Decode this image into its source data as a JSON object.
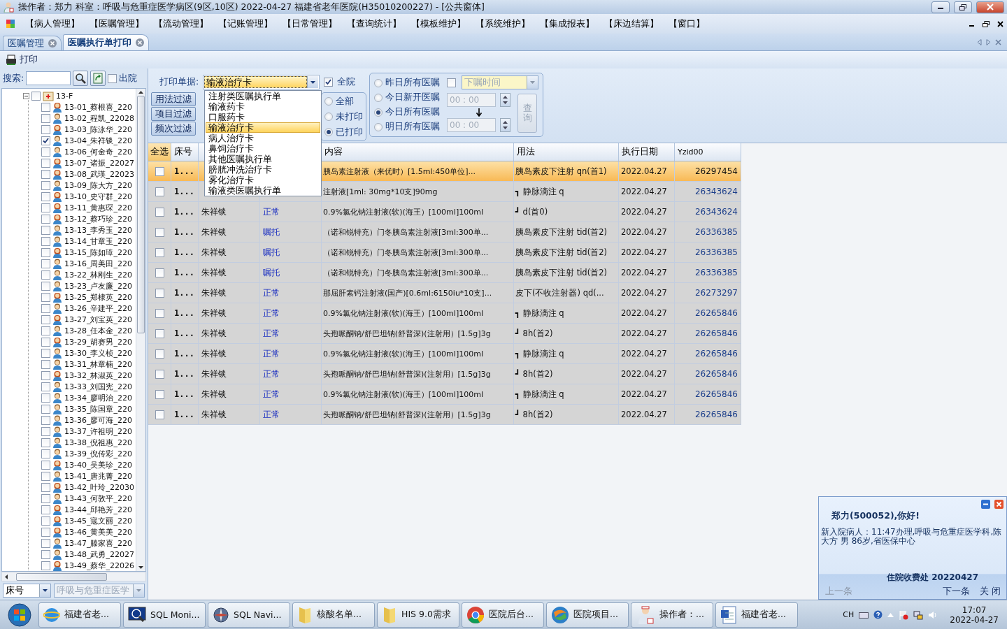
{
  "window": {
    "title": "操作者：郑力  科室：呼吸与危重症医学病区(9区,10区)  2022-04-27  福建省老年医院(H35010200227) - [公共窗体]"
  },
  "menu": [
    "【病人管理】",
    "【医嘱管理】",
    "【流动管理】",
    "【记账管理】",
    "【日常管理】",
    "【查询统计】",
    "【模板维护】",
    "【系统维护】",
    "【集成报表】",
    "【床边结算】",
    "【窗口】"
  ],
  "tabs": [
    {
      "label": "医嘱管理",
      "selected": false
    },
    {
      "label": "医嘱执行单打印",
      "selected": true
    }
  ],
  "toolbar": {
    "print": "打印"
  },
  "sidebar": {
    "search_label": "搜索:",
    "discharged_label": "出院",
    "discharged": false,
    "tree": {
      "label": "13-F",
      "expanded": true,
      "checked": false,
      "children": [
        {
          "label": "13-01_蔡根喜_220",
          "kind": "female",
          "checked": false
        },
        {
          "label": "13-02_程凯_22028",
          "kind": "male",
          "checked": false
        },
        {
          "label": "13-03_陈泳华_220",
          "kind": "female",
          "checked": false
        },
        {
          "label": "13-04_朱祥锬_220",
          "kind": "male",
          "checked": true
        },
        {
          "label": "13-06_何金奇_220",
          "kind": "male",
          "checked": false
        },
        {
          "label": "13-07_诸振_22027",
          "kind": "female",
          "checked": false
        },
        {
          "label": "13-08_武瑛_22023",
          "kind": "female",
          "checked": false
        },
        {
          "label": "13-09_陈大方_220",
          "kind": "male",
          "checked": false
        },
        {
          "label": "13-10_史守群_220",
          "kind": "female",
          "checked": false
        },
        {
          "label": "13-11_黄惠琛_220",
          "kind": "female",
          "checked": false
        },
        {
          "label": "13-12_蔡巧珍_220",
          "kind": "female",
          "checked": false
        },
        {
          "label": "13-13_李秀玉_220",
          "kind": "male",
          "checked": false
        },
        {
          "label": "13-14_甘章玉_220",
          "kind": "male",
          "checked": false
        },
        {
          "label": "13-15_陈如璋_220",
          "kind": "female",
          "checked": false
        },
        {
          "label": "13-16_周美田_220",
          "kind": "male",
          "checked": false
        },
        {
          "label": "13-22_林刚生_220",
          "kind": "male",
          "checked": false
        },
        {
          "label": "13-23_卢友廉_220",
          "kind": "male",
          "checked": false
        },
        {
          "label": "13-25_郑棣英_220",
          "kind": "female",
          "checked": false
        },
        {
          "label": "13-26_辛建平_220",
          "kind": "male",
          "checked": false
        },
        {
          "label": "13-27_刘宝英_220",
          "kind": "female",
          "checked": false
        },
        {
          "label": "13-28_任本金_220",
          "kind": "male",
          "checked": false
        },
        {
          "label": "13-29_胡赛男_220",
          "kind": "female",
          "checked": false
        },
        {
          "label": "13-30_李义桢_220",
          "kind": "male",
          "checked": false
        },
        {
          "label": "13-31_林章楠_220",
          "kind": "male",
          "checked": false
        },
        {
          "label": "13-32_林淑英_220",
          "kind": "female",
          "checked": false
        },
        {
          "label": "13-33_刘国宪_220",
          "kind": "male",
          "checked": false
        },
        {
          "label": "13-34_廖明治_220",
          "kind": "male",
          "checked": false
        },
        {
          "label": "13-35_陈国章_220",
          "kind": "male",
          "checked": false
        },
        {
          "label": "13-36_廖可海_220",
          "kind": "male",
          "checked": false
        },
        {
          "label": "13-37_许祖明_220",
          "kind": "male",
          "checked": false
        },
        {
          "label": "13-38_倪祖惠_220",
          "kind": "male",
          "checked": false
        },
        {
          "label": "13-39_倪传彩_220",
          "kind": "male",
          "checked": false
        },
        {
          "label": "13-40_吴美珍_220",
          "kind": "female",
          "checked": false
        },
        {
          "label": "13-41_唐兆菁_220",
          "kind": "male",
          "checked": false
        },
        {
          "label": "13-42_叶玲_22030",
          "kind": "female",
          "checked": false
        },
        {
          "label": "13-43_何敦平_220",
          "kind": "male",
          "checked": false
        },
        {
          "label": "13-44_邱艳芳_220",
          "kind": "female",
          "checked": false
        },
        {
          "label": "13-45_寇文丽_220",
          "kind": "female",
          "checked": false
        },
        {
          "label": "13-46_黄美美_220",
          "kind": "female",
          "checked": false
        },
        {
          "label": "13-47_滕家喜_220",
          "kind": "male",
          "checked": false
        },
        {
          "label": "13-48_武勇_22027",
          "kind": "male",
          "checked": false
        },
        {
          "label": "13-49_蔡华_22026",
          "kind": "female",
          "checked": false
        }
      ]
    },
    "sort_select": "床号",
    "ward_select": {
      "value": "呼吸与危重症医学",
      "disabled": true
    }
  },
  "filters": {
    "doc_label": "打印单据:",
    "doc_value": "输液治疗卡",
    "whole_hospital": {
      "label": "全院",
      "checked": true
    },
    "buttons": [
      "用法过滤",
      "项目过滤",
      "频次过滤"
    ],
    "print_state": [
      {
        "label": "全部",
        "selected": false
      },
      {
        "label": "未打印",
        "selected": false
      },
      {
        "label": "已打印",
        "selected": true
      }
    ],
    "range": [
      {
        "label": "昨日所有医嘱",
        "selected": false
      },
      {
        "label": "今日新开医嘱",
        "selected": false
      },
      {
        "label": "今日所有医嘱",
        "selected": true
      },
      {
        "label": "明日所有医嘱",
        "selected": false
      }
    ],
    "order_time": {
      "checked": false,
      "placeholder": "下嘱时间",
      "disabled": true
    },
    "time_from": "00 : 00",
    "time_to": "00 : 00",
    "query": {
      "label": "查询",
      "disabled": true
    }
  },
  "dropdown": [
    {
      "label": "注射类医嘱执行单",
      "selected": false
    },
    {
      "label": "输液药卡",
      "selected": false
    },
    {
      "label": "口服药卡",
      "selected": false
    },
    {
      "label": "输液治疗卡",
      "selected": true
    },
    {
      "label": "病人治疗卡",
      "selected": false
    },
    {
      "label": "鼻饲治疗卡",
      "selected": false
    },
    {
      "label": "其他医嘱执行单",
      "selected": false
    },
    {
      "label": "膀胱冲洗治疗卡",
      "selected": false
    },
    {
      "label": "雾化治疗卡",
      "selected": false
    },
    {
      "label": "输液类医嘱执行单",
      "selected": false
    }
  ],
  "table": {
    "header": {
      "select_all": "全选",
      "bed": "床号",
      "content": "内容",
      "usage": "用法",
      "date": "执行日期",
      "column_8": "Yzid00"
    },
    "rows": [
      {
        "selected": true,
        "checked": false,
        "bed": "1...",
        "content": "胰岛素注射液（来优时）[1.5ml:450单位]...",
        "usage": "胰岛素皮下注射 qn(首1)",
        "date": "2022.04.27",
        "id": "26297454"
      },
      {
        "selected": false,
        "checked": false,
        "bed": "1...",
        "content": "注射液[1ml: 30mg*10支]90mg",
        "usage": "┓ 静脉滴注 q",
        "date": "2022.04.27",
        "id": "26343624"
      },
      {
        "selected": false,
        "checked": false,
        "bed": "1...",
        "name": "朱祥锬",
        "status": "正常",
        "content": "0.9%氯化钠注射液(软)(海王）[100ml]100ml",
        "usage": "┛ d(首0)",
        "date": "2022.04.27",
        "id": "26343624"
      },
      {
        "selected": false,
        "checked": false,
        "bed": "1...",
        "name": "朱祥锬",
        "status": "嘱托",
        "content": "（诺和锐特充）门冬胰岛素注射液[3ml:300单...",
        "usage": "胰岛素皮下注射 tid(首2)",
        "date": "2022.04.27",
        "id": "26336385"
      },
      {
        "selected": false,
        "checked": false,
        "bed": "1...",
        "name": "朱祥锬",
        "status": "嘱托",
        "content": "（诺和锐特充）门冬胰岛素注射液[3ml:300单...",
        "usage": "胰岛素皮下注射 tid(首2)",
        "date": "2022.04.27",
        "id": "26336385"
      },
      {
        "selected": false,
        "checked": false,
        "bed": "1...",
        "name": "朱祥锬",
        "status": "嘱托",
        "content": "（诺和锐特充）门冬胰岛素注射液[3ml:300单...",
        "usage": "胰岛素皮下注射 tid(首2)",
        "date": "2022.04.27",
        "id": "26336385"
      },
      {
        "selected": false,
        "checked": false,
        "bed": "1...",
        "name": "朱祥锬",
        "status": "正常",
        "content": "那屈肝素钙注射液(国产)[0.6ml:6150iu*10支]...",
        "usage": "皮下(不收注射器) qd(...",
        "date": "2022.04.27",
        "id": "26273297"
      },
      {
        "selected": false,
        "checked": false,
        "bed": "1...",
        "name": "朱祥锬",
        "status": "正常",
        "content": "0.9%氯化钠注射液(软)(海王）[100ml]100ml",
        "usage": "┓ 静脉滴注 q",
        "date": "2022.04.27",
        "id": "26265846"
      },
      {
        "selected": false,
        "checked": false,
        "bed": "1...",
        "name": "朱祥锬",
        "status": "正常",
        "content": "头孢哌酮钠/舒巴坦钠(舒普深)(注射用）[1.5g]3g",
        "usage": "┛ 8h(首2)",
        "date": "2022.04.27",
        "id": "26265846"
      },
      {
        "selected": false,
        "checked": false,
        "bed": "1...",
        "name": "朱祥锬",
        "status": "正常",
        "content": "0.9%氯化钠注射液(软)(海王）[100ml]100ml",
        "usage": "┓ 静脉滴注 q",
        "date": "2022.04.27",
        "id": "26265846"
      },
      {
        "selected": false,
        "checked": false,
        "bed": "1...",
        "name": "朱祥锬",
        "status": "正常",
        "content": "头孢哌酮钠/舒巴坦钠(舒普深)(注射用）[1.5g]3g",
        "usage": "┛ 8h(首2)",
        "date": "2022.04.27",
        "id": "26265846"
      },
      {
        "selected": false,
        "checked": false,
        "bed": "1...",
        "name": "朱祥锬",
        "status": "正常",
        "content": "0.9%氯化钠注射液(软)(海王）[100ml]100ml",
        "usage": "┓ 静脉滴注 q",
        "date": "2022.04.27",
        "id": "26265846"
      },
      {
        "selected": false,
        "checked": false,
        "bed": "1...",
        "name": "朱祥锬",
        "status": "正常",
        "content": "头孢哌酮钠/舒巴坦钠(舒普深)(注射用）[1.5g]3g",
        "usage": "┛ 8h(首2)",
        "date": "2022.04.27",
        "id": "26265846"
      }
    ]
  },
  "notification": {
    "greeting": "郑力(500052),你好!",
    "message": "新入院病人：11:47办理,呼吸与危重症医学科,陈大方 男 86岁,省医保中心",
    "signature": "住院收费处  20220427",
    "prev": {
      "label": "上一条",
      "disabled": true
    },
    "next": "下一条",
    "close": "关 闭"
  },
  "taskbar": {
    "tasks": [
      {
        "label": "福建省老...",
        "kind": "browser"
      },
      {
        "label": "SQL Moni...",
        "kind": "monitor"
      },
      {
        "label": "SQL Navi...",
        "kind": "compass"
      },
      {
        "label": "核酸名单...",
        "kind": "folder"
      },
      {
        "label": "HIS 9.0需求",
        "kind": "folder"
      },
      {
        "label": "医院后台...",
        "kind": "chrome"
      },
      {
        "label": "医院项目...",
        "kind": "swirl"
      },
      {
        "label": "操作者：...",
        "kind": "nurse"
      },
      {
        "label": "福建省老...",
        "kind": "document"
      }
    ],
    "language": "CH",
    "time": "17:07",
    "date": "2022-04-27"
  }
}
